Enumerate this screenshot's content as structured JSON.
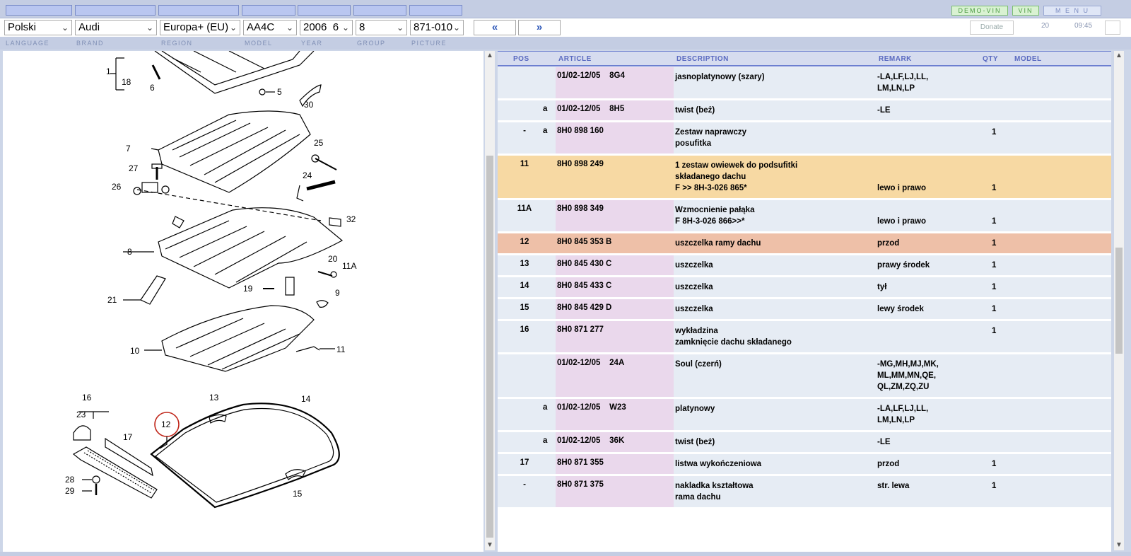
{
  "selectors": {
    "language": "Polski",
    "brand": "Audi",
    "region": "Europa+ (EU)",
    "model": "AA4C",
    "year": "2006  6",
    "group": "8",
    "picture": "871-010"
  },
  "nav": {
    "prev": "«",
    "next": "»"
  },
  "top_buttons": {
    "demo_vin": "DEMO-VIN",
    "vin": "VIN",
    "menu": "M E N U"
  },
  "right_info": {
    "donate": "Donate",
    "count": "20",
    "time": "09:45"
  },
  "labels": {
    "language": "LANGUAGE",
    "brand": "BRAND",
    "region": "REGION",
    "model": "MODEL",
    "year": "YEAR",
    "group": "GROUP",
    "picture": "PICTURE"
  },
  "table": {
    "headers": {
      "pos": "POS",
      "article": "ARTICLE",
      "description": "DESCRIPTION",
      "remark": "REMARK",
      "qty": "QTY",
      "model": "MODEL"
    },
    "rows": [
      {
        "pos": "",
        "sub": "",
        "article": "01/02-12/05    8G4",
        "description": "jasnoplatynowy (szary)",
        "remark": "-LA,LF,LJ,LL,\n LM,LN,LP",
        "qty": "",
        "style": ""
      },
      {
        "pos": "",
        "sub": "a",
        "article": "01/02-12/05    8H5",
        "description": "twist (beż)",
        "remark": "-LE",
        "qty": "",
        "style": ""
      },
      {
        "pos": "-",
        "sub": "a",
        "article": "8H0 898 160",
        "description": "Zestaw naprawczy\nposufitka",
        "remark": "",
        "qty": "1",
        "style": ""
      },
      {
        "pos": "11",
        "sub": "",
        "article": "8H0 898 249",
        "description": "1 zestaw owiewek do podsufitki\nskładanego dachu\nF          >> 8H-3-026 865*",
        "remark": "\n\nlewo i prawo",
        "qty": "\n\n1",
        "style": "orange"
      },
      {
        "pos": "11A",
        "sub": "",
        "article": "8H0 898 349",
        "description": "Wzmocnienie pałąka\nF 8H-3-026 866>>*",
        "remark": "\nlewo i prawo",
        "qty": "\n1",
        "style": ""
      },
      {
        "pos": "12",
        "sub": "",
        "article": "8H0 845 353 B",
        "description": "uszczelka ramy dachu",
        "remark": "przod",
        "qty": "1",
        "style": "salmon"
      },
      {
        "pos": "13",
        "sub": "",
        "article": "8H0 845 430 C",
        "description": "uszczelka",
        "remark": "prawy środek",
        "qty": "1",
        "style": ""
      },
      {
        "pos": "14",
        "sub": "",
        "article": "8H0 845 433 C",
        "description": "uszczelka",
        "remark": "tył",
        "qty": "1",
        "style": ""
      },
      {
        "pos": "15",
        "sub": "",
        "article": "8H0 845 429 D",
        "description": "uszczelka",
        "remark": "lewy środek",
        "qty": "1",
        "style": ""
      },
      {
        "pos": "16",
        "sub": "",
        "article": "8H0 871 277",
        "description": "wykładzina\nzamknięcie dachu składanego",
        "remark": "",
        "qty": "1",
        "style": ""
      },
      {
        "pos": "",
        "sub": "",
        "article": "01/02-12/05    24A",
        "description": "Soul (czerń)",
        "remark": "-MG,MH,MJ,MK,\n ML,MM,MN,QE,\n                QL,ZM,ZQ,ZU",
        "qty": "",
        "style": ""
      },
      {
        "pos": "",
        "sub": "a",
        "article": "01/02-12/05    W23",
        "description": "platynowy",
        "remark": "-LA,LF,LJ,LL,\n LM,LN,LP",
        "qty": "",
        "style": ""
      },
      {
        "pos": "",
        "sub": "a",
        "article": "01/02-12/05    36K",
        "description": "twist (beż)",
        "remark": "-LE",
        "qty": "",
        "style": ""
      },
      {
        "pos": "17",
        "sub": "",
        "article": "8H0 871 355",
        "description": "listwa wykończeniowa",
        "remark": "przod",
        "qty": "1",
        "style": ""
      },
      {
        "pos": "-",
        "sub": "",
        "article": "8H0 871 375",
        "description": "nakladka kształtowa\nrama dachu",
        "remark": "str. lewa",
        "qty": "1",
        "style": ""
      }
    ]
  },
  "diagram": {
    "callouts": [
      "1",
      "18",
      "6",
      "5",
      "30",
      "7",
      "25",
      "27",
      "24",
      "26",
      "32",
      "8",
      "20",
      "21",
      "11A",
      "19",
      "9",
      "10",
      "11",
      "16",
      "13",
      "14",
      "23",
      "12",
      "17",
      "28",
      "29",
      "15"
    ]
  }
}
